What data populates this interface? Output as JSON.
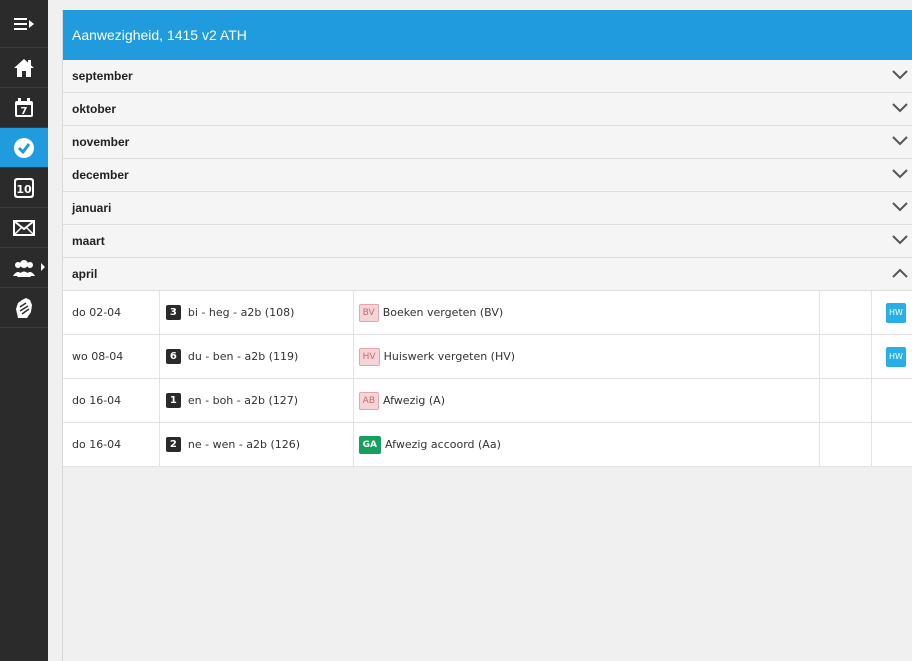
{
  "sidebar": {
    "items": [
      {
        "icon": "menu-toggle-icon"
      },
      {
        "icon": "home-icon"
      },
      {
        "icon": "calendar-icon",
        "badge": "7"
      },
      {
        "icon": "checkmark-icon",
        "active": true
      },
      {
        "icon": "grades-icon",
        "badge": "10"
      },
      {
        "icon": "mail-icon"
      },
      {
        "icon": "people-icon"
      },
      {
        "icon": "hands-icon"
      }
    ]
  },
  "header": {
    "title": "Aanwezigheid, 1415 v2 ATH"
  },
  "months": [
    {
      "label": "september",
      "expanded": false
    },
    {
      "label": "oktober",
      "expanded": false
    },
    {
      "label": "november",
      "expanded": false
    },
    {
      "label": "december",
      "expanded": false
    },
    {
      "label": "januari",
      "expanded": false
    },
    {
      "label": "maart",
      "expanded": false
    },
    {
      "label": "april",
      "expanded": true
    }
  ],
  "rows": [
    {
      "date": "do 02-04",
      "hour": "3",
      "lesson": "bi - heg - a2b (108)",
      "code": "BV",
      "code_style": "pink",
      "description": "Boeken vergeten (BV)",
      "hw": "HW"
    },
    {
      "date": "wo 08-04",
      "hour": "6",
      "lesson": "du - ben - a2b (119)",
      "code": "HV",
      "code_style": "pink",
      "description": "Huiswerk vergeten (HV)",
      "hw": "HW"
    },
    {
      "date": "do 16-04",
      "hour": "1",
      "lesson": "en - boh - a2b (127)",
      "code": "AB",
      "code_style": "pink",
      "description": "Afwezig (A)",
      "hw": ""
    },
    {
      "date": "do 16-04",
      "hour": "2",
      "lesson": "ne - wen - a2b (126)",
      "code": "GA",
      "code_style": "green",
      "description": "Afwezig accoord (Aa)",
      "hw": ""
    }
  ],
  "colors": {
    "accent": "#1f9bde",
    "sidebar": "#2b2b2b",
    "code_pink": "#f4d4d6",
    "code_green": "#16a05d",
    "hw_badge": "#29aee6"
  }
}
